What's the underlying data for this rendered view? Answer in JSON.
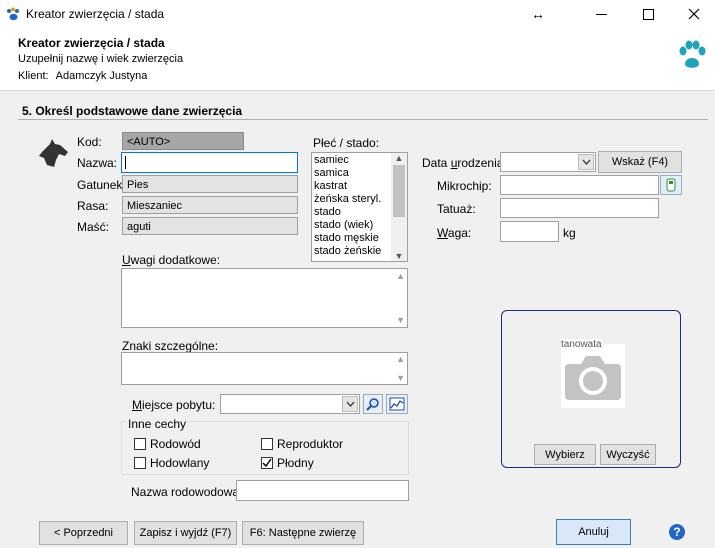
{
  "window": {
    "title": "Kreator zwierzęcia / stada",
    "controls": {
      "resize_glyph": "↔",
      "minimize_glyph": "—",
      "maximize_glyph": "☐",
      "close_glyph": "✕"
    }
  },
  "header": {
    "title": "Kreator zwierzęcia / stada",
    "subtitle": "Uzupełnij nazwę i wiek zwierzęcia",
    "client_label": "Klient:",
    "client_name": "Adamczyk  Justyna"
  },
  "section": {
    "title": "5. Określ podstawowe dane zwierzęcia"
  },
  "form": {
    "kod_label": "Kod:",
    "kod_value": "<AUTO>",
    "nazwa_label": "Nazwa:",
    "nazwa_value": "",
    "gatunek_label": "Gatunek:",
    "gatunek_value": "Pies",
    "rasa_label": "Rasa:",
    "rasa_value": "Mieszaniec",
    "masc_label": "Maść:",
    "masc_value": "aguti",
    "plec_label": "Płeć / stado:",
    "plec_options": [
      "samiec",
      "samica",
      "kastrat",
      "żeńska steryl.",
      "stado",
      "stado (wiek)",
      "stado męskie",
      "stado żeńskie"
    ],
    "data_label_pre": "Data ",
    "data_label_u": "u",
    "data_label_post": "rodzenia:",
    "data_value": "",
    "wskaz_button": "Wskaż (F4)",
    "mikrochip_label": "Mikrochip:",
    "mikrochip_value": "",
    "tatuaz_label": "Tatuaż:",
    "tatuaz_value": "",
    "waga_label_u": "W",
    "waga_label_post": "aga:",
    "waga_value": "",
    "waga_unit": "kg",
    "uwagi_label_u": "U",
    "uwagi_label_post": "wagi dodatkowe:",
    "uwagi_value": "",
    "znaki_label": "Znaki szczególne:",
    "znaki_value": "",
    "miejsce_label_u": "M",
    "miejsce_label_post": "iejsce pobytu:",
    "miejsce_value": "",
    "inne_cechy_label": "Inne cechy",
    "checkboxes": [
      {
        "label": "Rodowód",
        "checked": false
      },
      {
        "label": "Reproduktor",
        "checked": false
      },
      {
        "label": "Hodowlany",
        "checked": false
      },
      {
        "label": "Płodny",
        "checked": true
      }
    ],
    "nazwa_rodowodowa_label": "Nazwa rodowodowa:",
    "nazwa_rodowodowa_value": ""
  },
  "photo": {
    "overlay_text": "tanowata",
    "wybierz_button": "Wybierz",
    "wyczysc_button": "Wyczyść"
  },
  "footer": {
    "poprzedni_button": "< Poprzedni",
    "zapisz_button": "Zapisz i wyjdź (F7)",
    "nastepne_button": "F6: Następne zwierzę",
    "anuluj_button": "Anuluj",
    "help_glyph": "?"
  },
  "colors": {
    "accent": "#1e4e9c",
    "paw": "#1fa3b8",
    "anuluj_bg": "#d9e8f8",
    "readonly_bg": "#e3e3e3",
    "kod_bg": "#a6a6a6"
  }
}
